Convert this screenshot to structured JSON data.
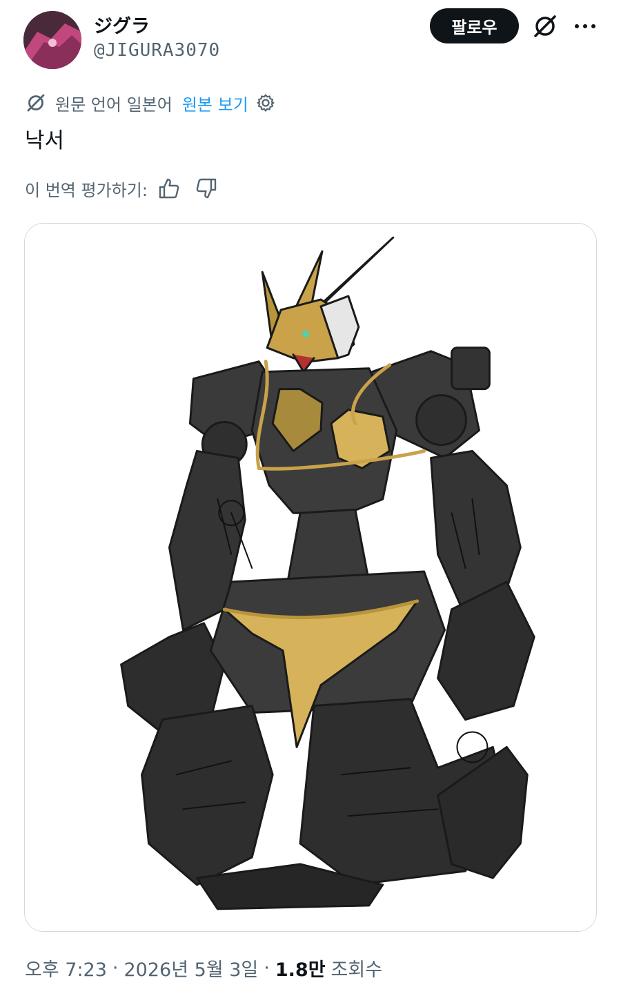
{
  "author": {
    "display_name": "ジグラ",
    "handle": "@JIGURA3070"
  },
  "header": {
    "follow_label": "팔로우",
    "grok_icon": "grok-icon",
    "more_icon": "more-dots-icon"
  },
  "translation": {
    "notice": "원문 언어 일본어",
    "show_original": "원본 보기",
    "settings_icon": "gear-icon"
  },
  "tweet": {
    "text": "낙서"
  },
  "rating": {
    "label": "이 번역 평가하기:",
    "up_icon": "thumbs-up-icon",
    "down_icon": "thumbs-down-icon"
  },
  "media": {
    "icon": "sketch-illustration"
  },
  "meta": {
    "time": "오후 7:23",
    "sep1": "·",
    "date": "2026년 5월 3일",
    "sep2": "·",
    "views_count": "1.8만",
    "views_label": "조회수"
  },
  "colors": {
    "text_primary": "#0f1419",
    "text_secondary": "#536471",
    "link": "#1d9bf0",
    "border": "#cfd9de",
    "button_bg": "#0f1419"
  }
}
